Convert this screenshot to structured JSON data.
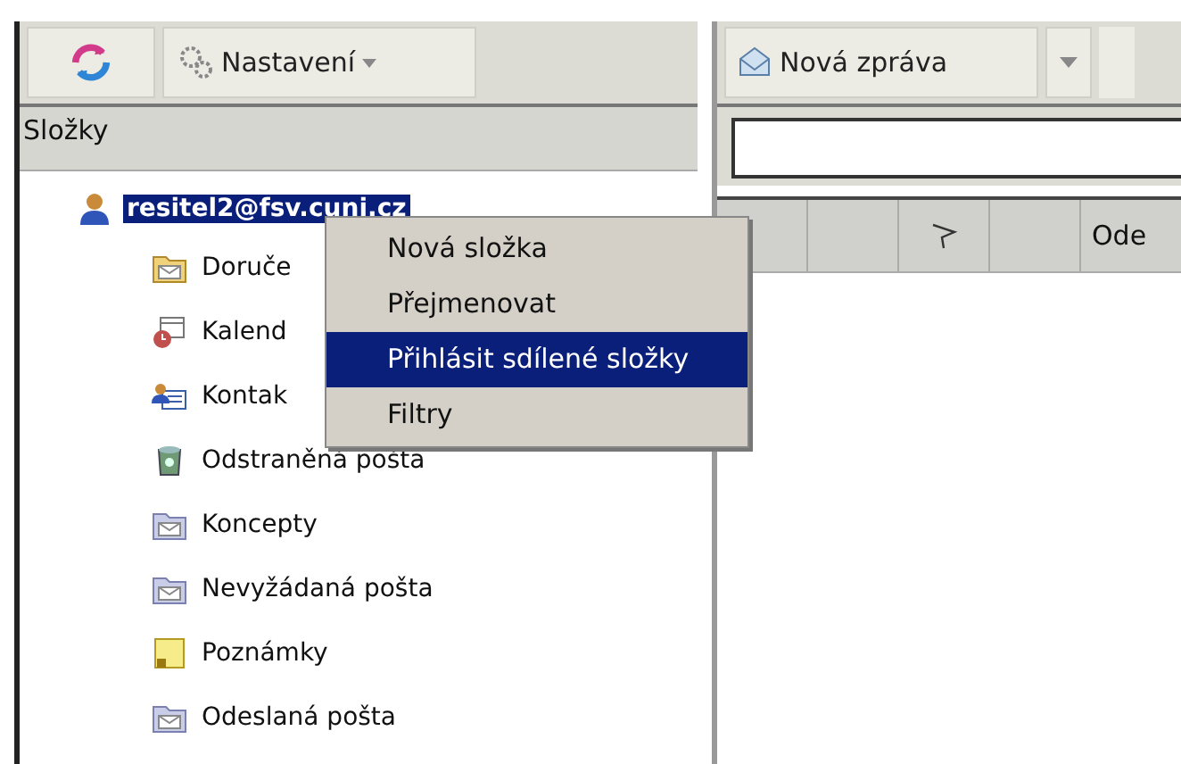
{
  "left_toolbar": {
    "settings_label": "Nastavení"
  },
  "folders_header": "Složky",
  "tree": [
    {
      "label": "resitel2@fsv.cuni.cz",
      "kind": "account",
      "selected": true,
      "children": [
        {
          "label": "Doruče",
          "kind": "inbox",
          "selected": false
        },
        {
          "label": "Kalend",
          "kind": "calendar",
          "selected": false
        },
        {
          "label": "Kontak",
          "kind": "contacts",
          "selected": false
        },
        {
          "label": "Odstraněná pošta",
          "kind": "trash",
          "selected": false
        },
        {
          "label": "Koncepty",
          "kind": "folder",
          "selected": false
        },
        {
          "label": "Nevyžádaná pošta",
          "kind": "folder",
          "selected": false
        },
        {
          "label": "Poznámky",
          "kind": "notes",
          "selected": false
        },
        {
          "label": "Odeslaná pošta",
          "kind": "folder",
          "selected": false
        }
      ]
    }
  ],
  "context_menu": [
    {
      "label": "Nová složka",
      "selected": false
    },
    {
      "label": "Přejmenovat",
      "selected": false
    },
    {
      "label": "Přihlásit sdílené složky",
      "selected": true
    },
    {
      "label": "Filtry",
      "selected": false
    }
  ],
  "right_toolbar": {
    "new_message_label": "Nová zpráva"
  },
  "message_list": {
    "column_5": "Ode"
  }
}
